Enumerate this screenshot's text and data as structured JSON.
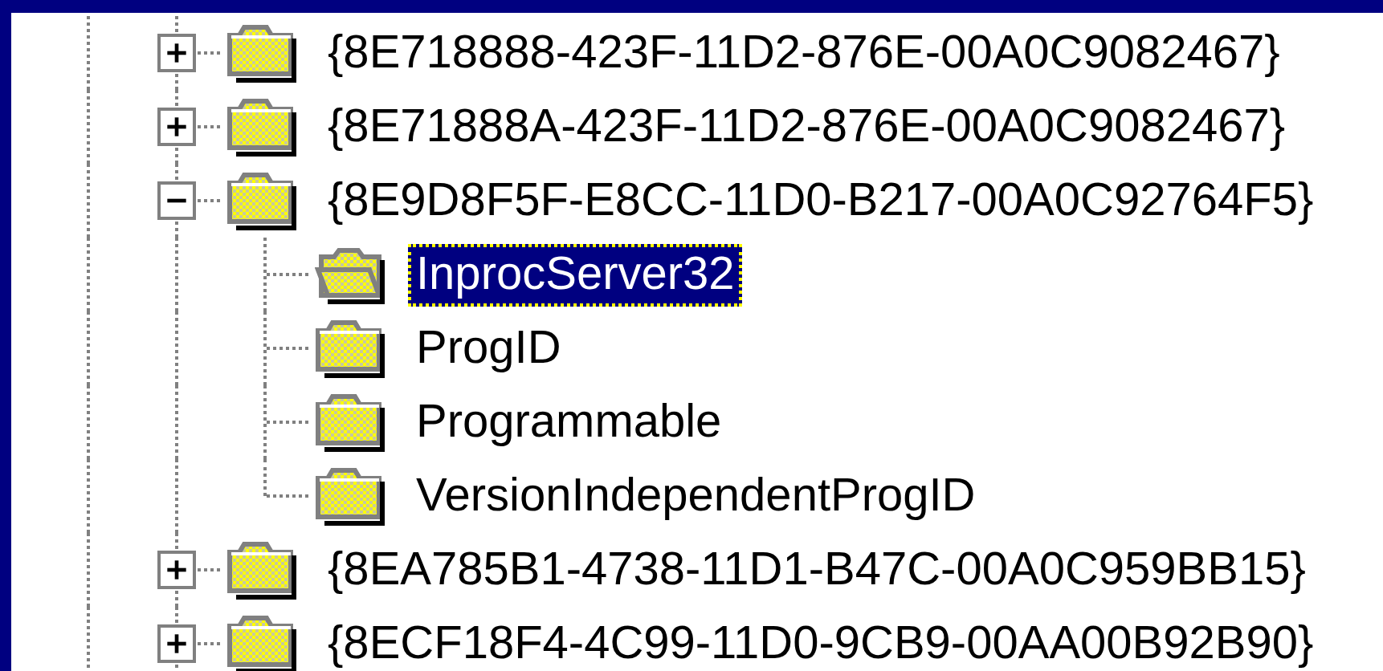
{
  "tree": {
    "items": [
      {
        "label": "{8E718888-423F-11D2-876E-00A0C9082467}",
        "expanded": false,
        "selected": false
      },
      {
        "label": "{8E71888A-423F-11D2-876E-00A0C9082467}",
        "expanded": false,
        "selected": false
      },
      {
        "label": "{8E9D8F5F-E8CC-11D0-B217-00A0C92764F5}",
        "expanded": true,
        "selected": false,
        "children": [
          {
            "label": "InprocServer32",
            "selected": true
          },
          {
            "label": "ProgID",
            "selected": false
          },
          {
            "label": "Programmable",
            "selected": false
          },
          {
            "label": "VersionIndependentProgID",
            "selected": false
          }
        ]
      },
      {
        "label": "{8EA785B1-4738-11D1-B47C-00A0C959BB15}",
        "expanded": false,
        "selected": false
      },
      {
        "label": "{8ECF18F4-4C99-11D0-9CB9-00AA00B92B90}",
        "expanded": false,
        "selected": false
      }
    ]
  }
}
